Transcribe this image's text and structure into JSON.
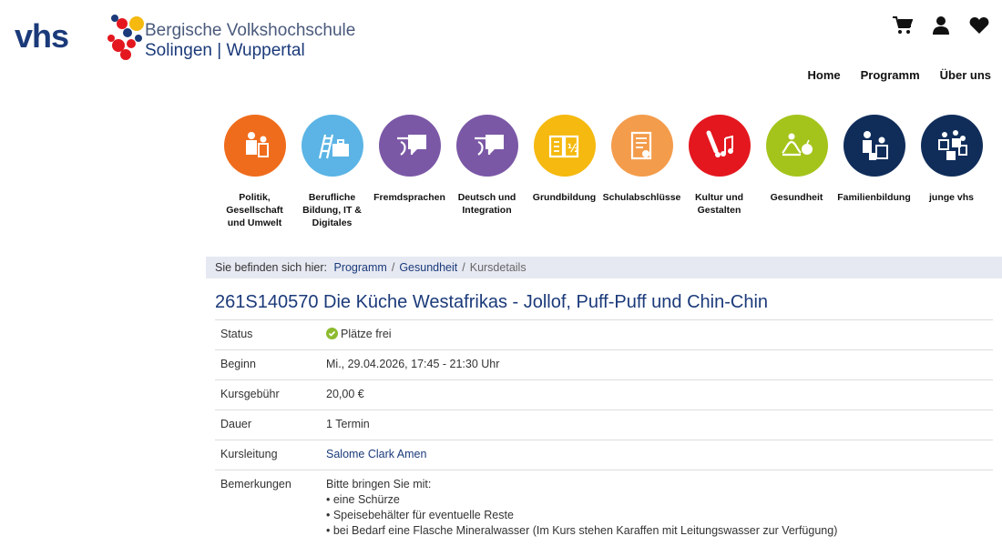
{
  "logo": {
    "text": "vhs",
    "org_line1": "Bergische Volkshochschule",
    "org_line2": "Solingen | Wuppertal"
  },
  "header_icons": [
    "cart-icon",
    "user-icon",
    "heart-icon"
  ],
  "topnav": [
    "Home",
    "Programm",
    "Über uns"
  ],
  "categories": [
    {
      "label": "Politik, Gesellschaft und Umwelt",
      "color": "#ef6c1c",
      "icon": "people-icon"
    },
    {
      "label": "Berufliche Bildung, IT & Digitales",
      "color": "#5bb4e5",
      "icon": "ladder-briefcase-icon"
    },
    {
      "label": "Fremdsprachen",
      "color": "#7b58a6",
      "icon": "speech-icon"
    },
    {
      "label": "Deutsch und Integration",
      "color": "#7b58a6",
      "icon": "speech-icon"
    },
    {
      "label": "Grundbildung",
      "color": "#f5b90f",
      "icon": "book-icon"
    },
    {
      "label": "Schulabschlüsse",
      "color": "#f39c4c",
      "icon": "certificate-icon"
    },
    {
      "label": "Kultur und Gestalten",
      "color": "#e4171f",
      "icon": "brush-music-icon"
    },
    {
      "label": "Gesundheit",
      "color": "#a4c41c",
      "icon": "yoga-apple-icon"
    },
    {
      "label": "Familienbildung",
      "color": "#102d5a",
      "icon": "family-icon"
    },
    {
      "label": "junge vhs",
      "color": "#102d5a",
      "icon": "group-icon"
    }
  ],
  "breadcrumb": {
    "prefix": "Sie befinden sich hier:",
    "items": [
      "Programm",
      "Gesundheit"
    ],
    "current": "Kursdetails"
  },
  "course": {
    "title": "261S140570 Die Küche Westafrikas - Jollof, Puff-Puff und Chin-Chin",
    "rows": [
      {
        "key": "Status",
        "value": "Plätze frei"
      },
      {
        "key": "Beginn",
        "value": "Mi., 29.04.2026, 17:45 - 21:30 Uhr"
      },
      {
        "key": "Kursgebühr",
        "value": "20,00 €"
      },
      {
        "key": "Dauer",
        "value": "1 Termin"
      },
      {
        "key": "Kursleitung",
        "value": "Salome Clark Amen"
      },
      {
        "key": "Bemerkungen",
        "value": "Bitte bringen Sie mit:"
      }
    ],
    "remarks": [
      "• eine Schürze",
      "• Speisebehälter für eventuelle Reste",
      "• bei Bedarf eine Flasche Mineralwasser (Im Kurs stehen Karaffen mit Leitungswasser zur Verfügung)"
    ]
  }
}
